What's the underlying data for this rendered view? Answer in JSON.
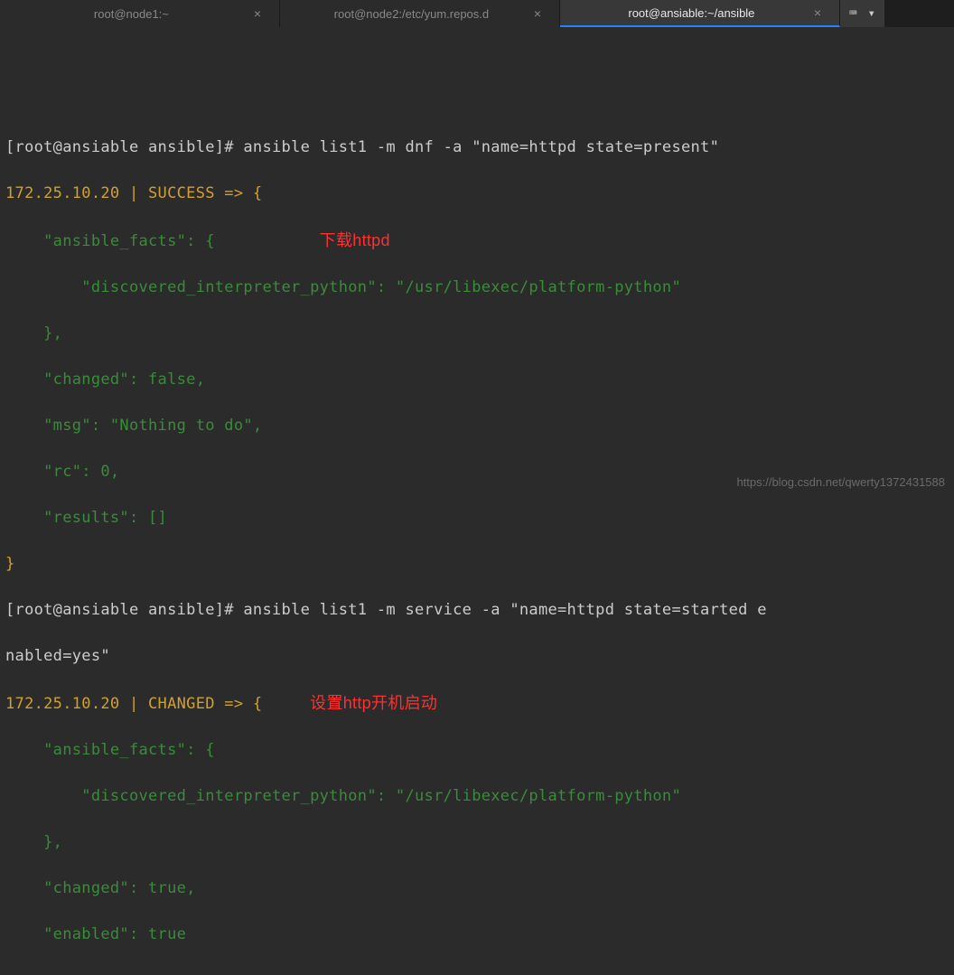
{
  "tabs": [
    {
      "label": "root@node1:~",
      "active": false
    },
    {
      "label": "root@node2:/etc/yum.repos.d",
      "active": false
    },
    {
      "label": "root@ansiable:~/ansible",
      "active": true
    }
  ],
  "toolbar": {
    "kbd_icon": "⌨",
    "menu_icon": "▾"
  },
  "prompt1": "[root@ansiable ansible]# ",
  "cmd1": "ansible list1 -m dnf -a \"name=httpd state=present\"",
  "out1_header": "172.25.10.20 | SUCCESS => {",
  "annotation1": "下载httpd",
  "out1": {
    "l2a": "    \"ansible_facts\": {",
    "l3": "        \"discovered_interpreter_python\": \"/usr/libexec/platform-python\"",
    "l4": "    },",
    "l5": "    \"changed\": false,",
    "l6": "    \"msg\": \"Nothing to do\",",
    "l7": "    \"rc\": 0,",
    "l8": "    \"results\": []",
    "l9": "}"
  },
  "prompt2": "[root@ansiable ansible]# ",
  "cmd2a": "ansible list1 -m service -a \"name=httpd state=started e",
  "cmd2b": "nabled=yes\"",
  "out2_header": "172.25.10.20 | CHANGED => {",
  "annotation2": "设置http开机启动",
  "out2": {
    "l2": "    \"ansible_facts\": {",
    "l3": "        \"discovered_interpreter_python\": \"/usr/libexec/platform-python\"",
    "l4": "    },",
    "l5": "    \"changed\": true,",
    "l6": "    \"enabled\": true"
  },
  "watermark": "https://blog.csdn.net/qwerty1372431588"
}
